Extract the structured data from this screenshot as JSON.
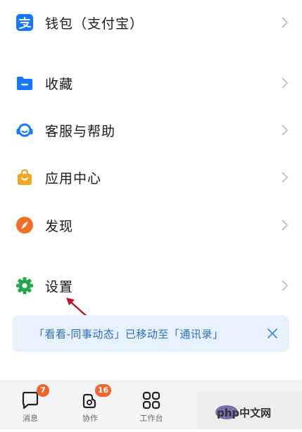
{
  "menu": [
    {
      "label": "钱包（支付宝）",
      "icon": "alipay-icon",
      "color": "#1677ff"
    },
    {
      "label": "收藏",
      "icon": "folder-icon",
      "color": "#1677ff"
    },
    {
      "label": "客服与帮助",
      "icon": "headset-icon",
      "color": "#1677ff"
    },
    {
      "label": "应用中心",
      "icon": "shopping-bag-icon",
      "color": "#f5a623"
    },
    {
      "label": "发现",
      "icon": "compass-icon",
      "color": "#f07028"
    },
    {
      "label": "设置",
      "icon": "gear-icon",
      "color": "#22a84a"
    }
  ],
  "toast": {
    "message": "「看看-同事动态」已移动至「通讯录」"
  },
  "tabbar": {
    "tabs": [
      {
        "label": "消息",
        "badge": "7",
        "icon": "chat-icon"
      },
      {
        "label": "协作",
        "badge": "16",
        "icon": "collaboration-icon"
      },
      {
        "label": "工作台",
        "badge": "",
        "icon": "grid-icon"
      }
    ]
  },
  "watermark": {
    "text": "php中文网"
  }
}
